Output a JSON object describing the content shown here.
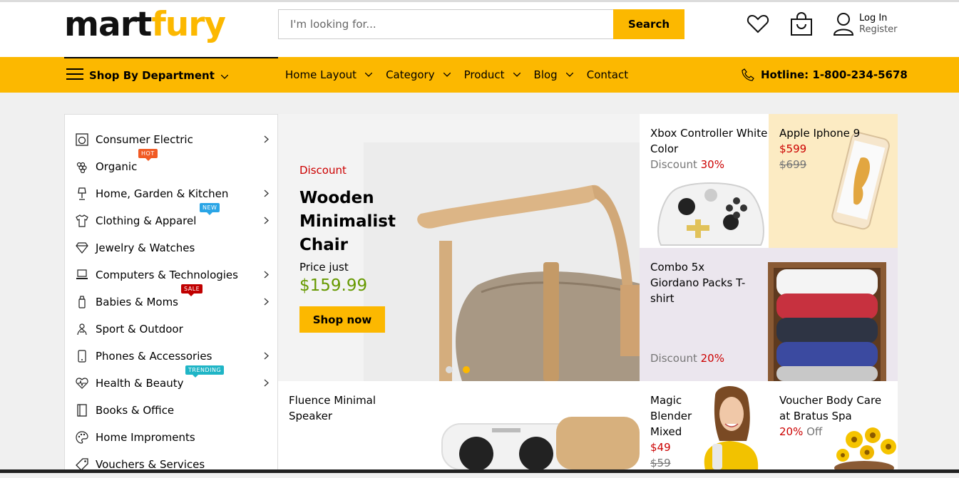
{
  "brand": {
    "part1": "mart",
    "part2": "fury"
  },
  "search": {
    "placeholder": "I'm looking for...",
    "button": "Search"
  },
  "account": {
    "login": "Log In",
    "register": "Register"
  },
  "nav": {
    "department": "Shop By Department",
    "items": [
      "Home Layout",
      "Category",
      "Product",
      "Blog",
      "Contact"
    ],
    "hotline": "Hotline: 1-800-234-5678"
  },
  "categories": [
    {
      "label": "Consumer Electric",
      "arrow": true
    },
    {
      "label": "Organic",
      "badge": "HOT",
      "badge_color": "#f15a24"
    },
    {
      "label": "Home, Garden & Kitchen",
      "arrow": true
    },
    {
      "label": "Clothing & Apparel",
      "arrow": true,
      "badge": "NEW",
      "badge_color": "#2aa5e6"
    },
    {
      "label": "Jewelry & Watches"
    },
    {
      "label": "Computers & Technologies",
      "arrow": true
    },
    {
      "label": "Babies & Moms",
      "arrow": true,
      "badge": "SALE",
      "badge_color": "#c00000"
    },
    {
      "label": "Sport & Outdoor"
    },
    {
      "label": "Phones & Accessories",
      "arrow": true
    },
    {
      "label": "Health & Beauty",
      "arrow": true,
      "badge": "TRENDING",
      "badge_color": "#1fb5c6"
    },
    {
      "label": "Books & Office"
    },
    {
      "label": "Home Improments"
    },
    {
      "label": "Vouchers & Services"
    }
  ],
  "hero": {
    "tag": "Discount",
    "title": "Wooden Minimalist Chair",
    "price_label": "Price just",
    "price": "$159.99",
    "cta": "Shop now",
    "slide_active": 2
  },
  "promos": {
    "xbox": {
      "title": "Xbox Controller White Color",
      "discount_label": "Discount",
      "discount": "30%"
    },
    "iphone": {
      "title": "Apple Iphone 9",
      "price": "$599",
      "old_price": "$699"
    },
    "tshirt": {
      "title": "Combo 5x Giordano Packs T-shirt",
      "discount_label": "Discount",
      "discount": "20%"
    },
    "speaker": {
      "title": "Fluence Minimal Speaker"
    },
    "blender": {
      "title": "Magic Blender Mixed",
      "price": "$49",
      "old_price": "$59"
    },
    "voucher": {
      "title": "Voucher Body Care at Bratus Spa",
      "discount": "20%",
      "off": "Off"
    }
  },
  "colors": {
    "accent": "#fcb800",
    "sale": "#cc0000",
    "price_green": "#669900"
  }
}
